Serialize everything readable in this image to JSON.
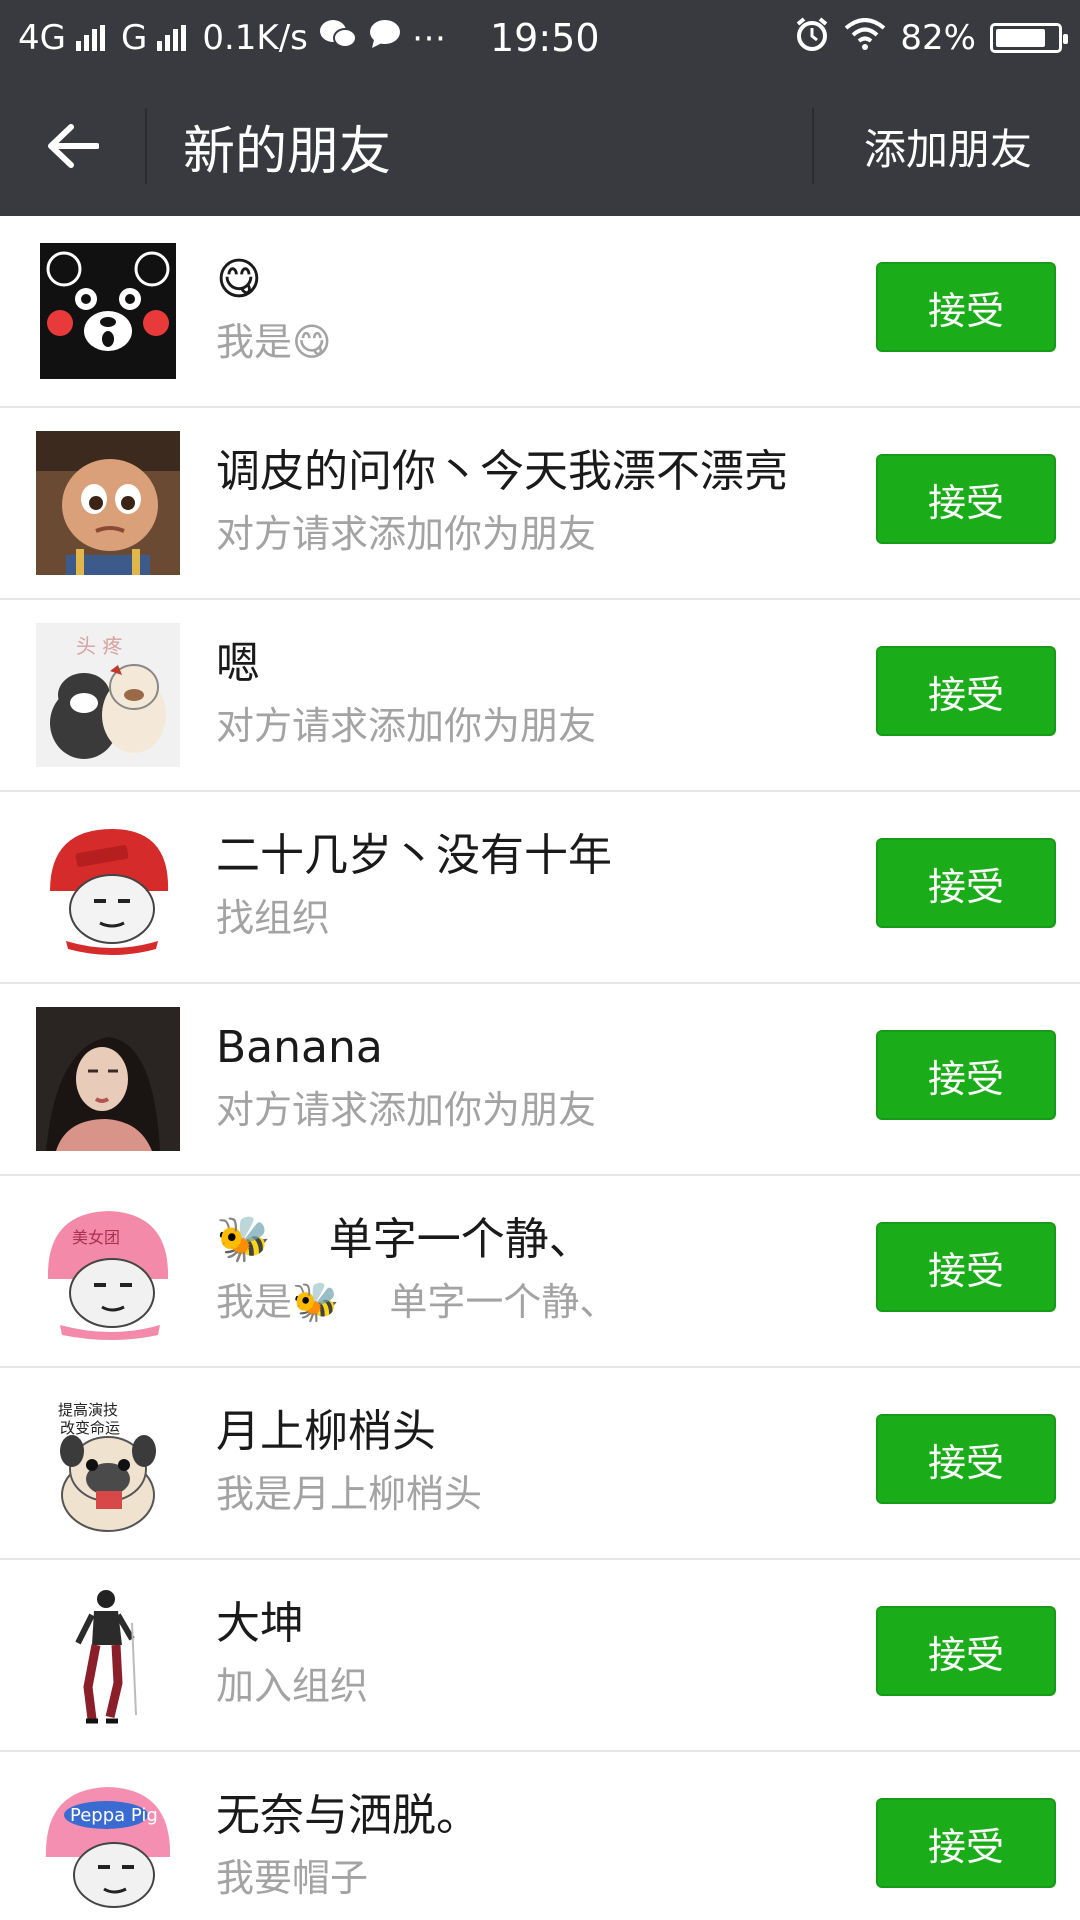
{
  "status_bar": {
    "network1": "4G",
    "network2": "G",
    "speed": "0.1K/s",
    "time": "19:50",
    "battery": "82%",
    "battery_level": 0.82
  },
  "nav": {
    "title": "新的朋友",
    "add_friend": "添加朋友"
  },
  "requests": [
    {
      "name": "😋",
      "message": "我是😋",
      "button": "接受",
      "avatar": "kumamon-avatar"
    },
    {
      "name": "调皮的问你丶今天我漂不漂亮",
      "message": "对方请求添加你为朋友",
      "button": "接受",
      "avatar": "cartoon-girl-avatar"
    },
    {
      "name": "嗯",
      "message": "对方请求添加你为朋友",
      "button": "接受",
      "avatar": "cat-dog-avatar"
    },
    {
      "name": "二十几岁丶没有十年",
      "message": "找组织",
      "button": "接受",
      "avatar": "red-helmet-meme-avatar"
    },
    {
      "name": "Banana",
      "message": "对方请求添加你为朋友",
      "button": "接受",
      "avatar": "woman-photo-avatar"
    },
    {
      "name": "🐝　 单字一个静、",
      "message": "我是🐝　 单字一个静、",
      "button": "接受",
      "avatar": "pink-helmet-meme-avatar"
    },
    {
      "name": "月上柳梢头",
      "message": "我是月上柳梢头",
      "button": "接受",
      "avatar": "pug-avatar"
    },
    {
      "name": "大坤",
      "message": "加入组织",
      "button": "接受",
      "avatar": "dancer-avatar"
    },
    {
      "name": "无奈与洒脱。",
      "message": "我要帽子",
      "button": "接受",
      "avatar": "peppa-helmet-meme-avatar"
    }
  ],
  "colors": {
    "bar": "#393a3f",
    "accept": "#1aad19",
    "subtext": "#a3a3a3"
  }
}
